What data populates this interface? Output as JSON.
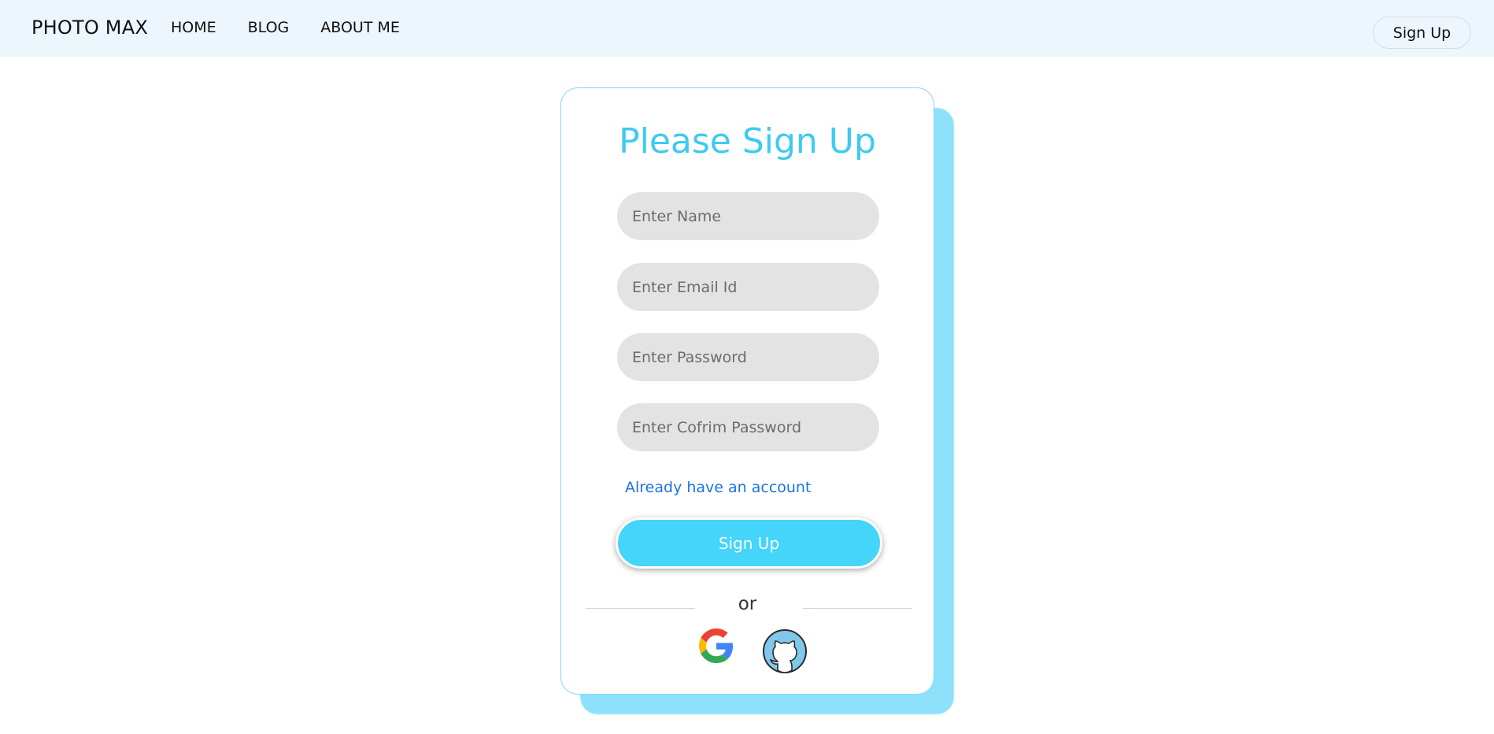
{
  "navbar": {
    "brand": "PHOTO MAX",
    "links": [
      "HOME",
      "BLOG",
      "ABOUT ME"
    ],
    "signup_label": "Sign Up"
  },
  "form": {
    "title": "Please Sign Up",
    "fields": [
      {
        "placeholder": "Enter Name",
        "value": ""
      },
      {
        "placeholder": "Enter Email Id",
        "value": ""
      },
      {
        "placeholder": "Enter Password",
        "value": ""
      },
      {
        "placeholder": "Enter Cofrim Password",
        "value": ""
      }
    ],
    "login_link": "Already have an account",
    "submit_label": "Sign Up",
    "divider": "or",
    "social": [
      {
        "icon": "google-icon"
      },
      {
        "icon": "github-icon"
      }
    ]
  },
  "colors": {
    "navbar_bg": "#eef6fd",
    "accent": "#45d4fa",
    "title": "#3fcaf1",
    "card_shadow": "#8de1fb",
    "link": "#1a73e8"
  }
}
